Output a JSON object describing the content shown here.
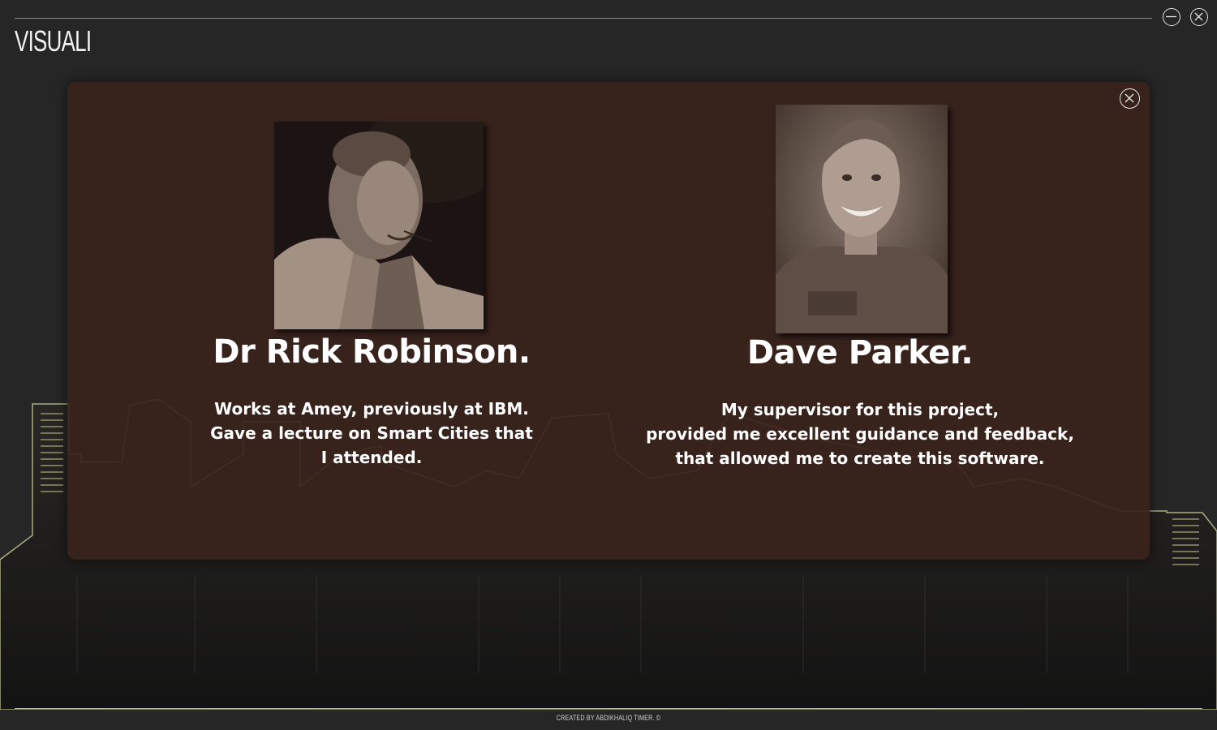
{
  "app": {
    "title": "VISUALI",
    "footer": "CREATED BY ABDIKHALIQ TIMER. ©"
  },
  "window_controls": {
    "minimize_icon": "minimize-icon",
    "close_icon": "close-icon"
  },
  "modal": {
    "close_icon": "close-icon",
    "people": [
      {
        "name": "Dr Rick Robinson.",
        "description_lines": [
          "Works at Amey, previously at IBM.",
          "Gave a lecture on Smart Cities that",
          "I attended."
        ]
      },
      {
        "name": "Dave Parker.",
        "description_lines": [
          "My supervisor for this project,",
          "provided me excellent guidance and feedback,",
          "that allowed me to create this software."
        ]
      }
    ]
  },
  "colors": {
    "background": "#262626",
    "modal": "#3a221c",
    "skyline_outline": "#b8bb8a"
  }
}
